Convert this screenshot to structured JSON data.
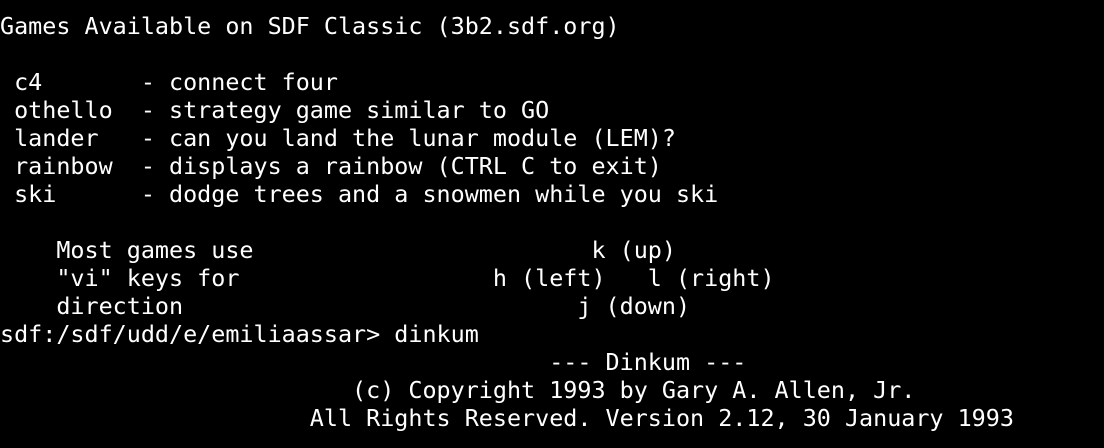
{
  "terminal": {
    "lines": [
      "Games Available on SDF Classic (3b2.sdf.org)",
      "",
      " c4       - connect four",
      " othello  - strategy game similar to GO",
      " lander   - can you land the lunar module (LEM)?",
      " rainbow  - displays a rainbow (CTRL C to exit)",
      " ski      - dodge trees and a snowmen while you ski",
      "",
      "    Most games use                        k (up)",
      "    \"vi\" keys for                  h (left)   l (right)",
      "    direction                            j (down)",
      "sdf:/sdf/udd/e/emiliaassar> dinkum",
      "                                       --- Dinkum ---",
      "                         (c) Copyright 1993 by Gary A. Allen, Jr.",
      "                      All Rights Reserved. Version 2.12, 30 January 1993"
    ]
  },
  "colors": {
    "background": "#000000",
    "foreground": "#ffffff"
  }
}
